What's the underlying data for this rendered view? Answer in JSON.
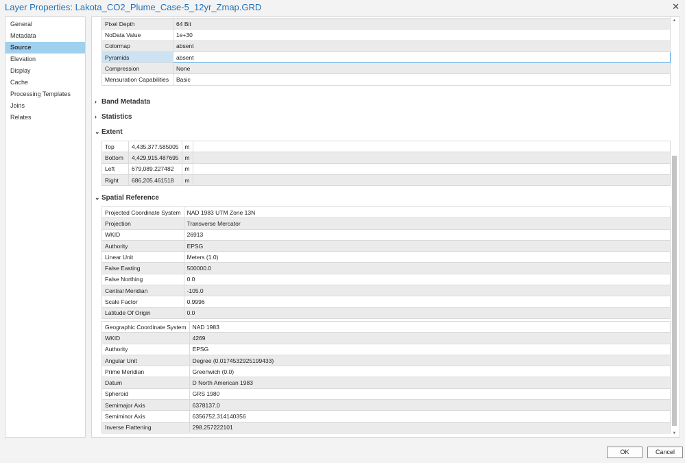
{
  "title": "Layer Properties: Lakota_CO2_Plume_Case-5_12yr_Zmap.GRD",
  "sidebar": {
    "items": [
      "General",
      "Metadata",
      "Source",
      "Elevation",
      "Display",
      "Cache",
      "Processing Templates",
      "Joins",
      "Relates"
    ],
    "selected": "Source"
  },
  "raster_info": [
    [
      "Pixel Depth",
      "64 Bit"
    ],
    [
      "NoData Value",
      "1e+30"
    ],
    [
      "Colormap",
      "absent"
    ],
    [
      "Pyramids",
      "absent"
    ],
    [
      "Compression",
      "None"
    ],
    [
      "Mensuration Capabilities",
      "Basic"
    ]
  ],
  "sections": {
    "band_metadata": "Band Metadata",
    "statistics": "Statistics",
    "extent": "Extent",
    "spatial_reference": "Spatial Reference"
  },
  "extent": [
    [
      "Top",
      "4,435,377.585005",
      "m"
    ],
    [
      "Bottom",
      "4,429,915.487695",
      "m"
    ],
    [
      "Left",
      "679,089.227482",
      "m"
    ],
    [
      "Right",
      "686,205.461518",
      "m"
    ]
  ],
  "projected": [
    [
      "Projected Coordinate System",
      "NAD 1983 UTM Zone 13N"
    ],
    [
      "Projection",
      "Transverse Mercator"
    ],
    [
      "WKID",
      "26913"
    ],
    [
      "Authority",
      "EPSG"
    ],
    [
      "Linear Unit",
      "Meters (1.0)"
    ],
    [
      "False Easting",
      "500000.0"
    ],
    [
      "False Northing",
      "0.0"
    ],
    [
      "Central Meridian",
      "-105.0"
    ],
    [
      "Scale Factor",
      "0.9996"
    ],
    [
      "Latitude Of Origin",
      "0.0"
    ]
  ],
  "geographic": [
    [
      "Geographic Coordinate System",
      "NAD 1983"
    ],
    [
      "WKID",
      "4269"
    ],
    [
      "Authority",
      "EPSG"
    ],
    [
      "Angular Unit",
      "Degree (0.0174532925199433)"
    ],
    [
      "Prime Meridian",
      "Greenwich (0.0)"
    ],
    [
      "Datum",
      "D North American 1983"
    ],
    [
      "Spheroid",
      "GRS 1980"
    ],
    [
      "Semimajor Axis",
      "6378137.0"
    ],
    [
      "Semiminor Axis",
      "6356752.314140356"
    ],
    [
      "Inverse Flattening",
      "298.257222101"
    ]
  ],
  "buttons": {
    "ok": "OK",
    "cancel": "Cancel"
  }
}
